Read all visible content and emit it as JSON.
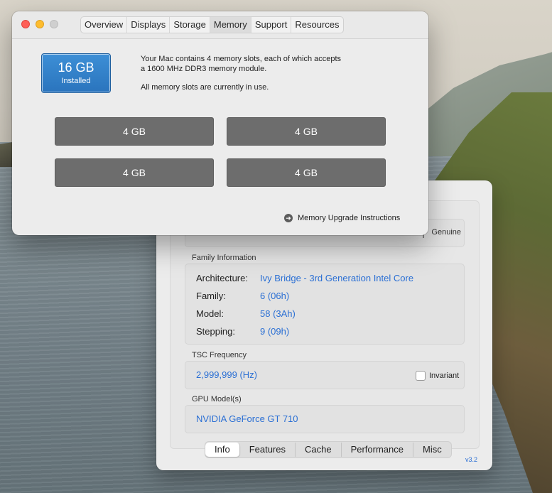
{
  "about_mac": {
    "tabs": [
      {
        "label": "Overview"
      },
      {
        "label": "Displays"
      },
      {
        "label": "Storage"
      },
      {
        "label": "Memory"
      },
      {
        "label": "Support"
      },
      {
        "label": "Resources"
      }
    ],
    "active_tab": "Memory",
    "badge": {
      "amount": "16 GB",
      "status": "Installed",
      "color": "#2a74bd"
    },
    "info_line1": "Your Mac contains 4 memory slots, each of which accepts",
    "info_line2": "a 1600 MHz DDR3 memory module.",
    "info_line3": "All memory slots are currently in use.",
    "slots": [
      {
        "label": "4 GB"
      },
      {
        "label": "4 GB"
      },
      {
        "label": "4 GB"
      },
      {
        "label": "4 GB"
      }
    ],
    "upgrade_link": "Memory Upgrade Instructions",
    "upgrade_icon": "arrow-right-circle-icon"
  },
  "cpu_app": {
    "peek_value": "Genuine",
    "family_title": "Family Information",
    "family_rows": [
      {
        "label": "Architecture:",
        "value": "Ivy Bridge - 3rd Generation Intel Core"
      },
      {
        "label": "Family:",
        "value": "6 (06h)"
      },
      {
        "label": "Model:",
        "value": "58 (3Ah)"
      },
      {
        "label": "Stepping:",
        "value": "9 (09h)"
      }
    ],
    "tsc_title": "TSC Frequency",
    "tsc_value": "2,999,999 (Hz)",
    "invariant_label": "Invariant",
    "invariant_checked": false,
    "gpu_title": "GPU Model(s)",
    "gpu_value": "NVIDIA GeForce GT 710",
    "bottom_tabs": [
      {
        "label": "Info"
      },
      {
        "label": "Features"
      },
      {
        "label": "Cache"
      },
      {
        "label": "Performance"
      },
      {
        "label": "Misc"
      }
    ],
    "active_bottom_tab": "Info",
    "version": "v3.2",
    "value_color": "#2a6fd4"
  }
}
